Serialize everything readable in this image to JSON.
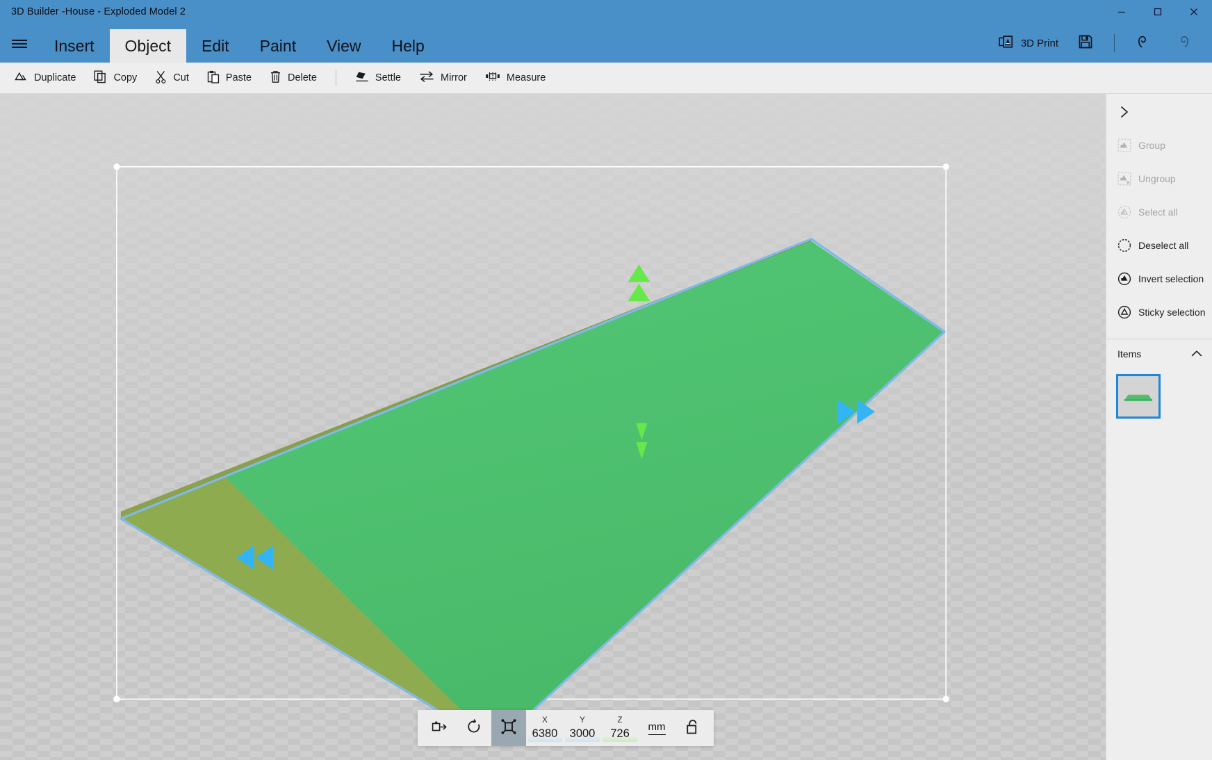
{
  "window": {
    "title": "3D Builder  -House - Exploded Model 2",
    "minimize_label": "Minimize",
    "maximize_label": "Maximize",
    "close_label": "Close",
    "accent_color": "#4a90c8"
  },
  "menubar": {
    "hamburger_label": "Menu",
    "tabs": [
      {
        "label": "Insert",
        "active": false
      },
      {
        "label": "Object",
        "active": true
      },
      {
        "label": "Edit",
        "active": false
      },
      {
        "label": "Paint",
        "active": false
      },
      {
        "label": "View",
        "active": false
      },
      {
        "label": "Help",
        "active": false
      }
    ],
    "print_label": "3D Print",
    "save_label": "Save",
    "undo_label": "Undo",
    "redo_label": "Redo",
    "redo_disabled": true
  },
  "toolbar": {
    "items": [
      {
        "label": "Duplicate",
        "icon": "duplicate-icon"
      },
      {
        "label": "Copy",
        "icon": "copy-icon"
      },
      {
        "label": "Cut",
        "icon": "cut-icon"
      },
      {
        "label": "Paste",
        "icon": "paste-icon"
      },
      {
        "label": "Delete",
        "icon": "delete-icon"
      }
    ],
    "items2": [
      {
        "label": "Settle",
        "icon": "settle-icon"
      },
      {
        "label": "Mirror",
        "icon": "mirror-icon"
      },
      {
        "label": "Measure",
        "icon": "measure-icon"
      }
    ]
  },
  "sidebar": {
    "expand_label": "Expand panel",
    "items": [
      {
        "label": "Group",
        "icon": "group-icon",
        "disabled": true
      },
      {
        "label": "Ungroup",
        "icon": "ungroup-icon",
        "disabled": true
      },
      {
        "label": "Select all",
        "icon": "select-all-icon",
        "disabled": true
      },
      {
        "label": "Deselect all",
        "icon": "deselect-all-icon",
        "disabled": false
      },
      {
        "label": "Invert selection",
        "icon": "invert-selection-icon",
        "disabled": false
      },
      {
        "label": "Sticky selection",
        "icon": "sticky-selection-icon",
        "disabled": false
      }
    ],
    "items_panel": {
      "title": "Items",
      "collapse_icon": "chevron-up-icon",
      "thumbnails": [
        {
          "name": "Exploded Model 2",
          "selected": true,
          "color": "#4cbf6e"
        }
      ]
    }
  },
  "viewport": {
    "selection_color": "#ffffff",
    "model_outline_color": "#7fb9e8",
    "model_face_light": "#4cbf6e",
    "model_face_dark": "#8fab4f",
    "gizmo_green": "#66e84a",
    "gizmo_blue": "#33b5f5",
    "gizmo_labels": {
      "up_arrows": "move-up-gizmo",
      "down_arrows": "move-down-gizmo",
      "left_arrows": "move-left-gizmo",
      "right_arrows": "move-right-gizmo"
    }
  },
  "bottombar": {
    "tools": [
      {
        "name": "move-tool",
        "icon": "move-icon",
        "active": false
      },
      {
        "name": "rotate-tool",
        "icon": "rotate-icon",
        "active": false
      },
      {
        "name": "scale-tool",
        "icon": "scale-icon",
        "active": true
      }
    ],
    "fields": [
      {
        "label": "X",
        "value": "6380",
        "bar_color": "#cfe4f2"
      },
      {
        "label": "Y",
        "value": "3000",
        "bar_color": "#cfe4f2"
      },
      {
        "label": "Z",
        "value": "726",
        "bar_color": "#ccecbf"
      }
    ],
    "unit": "mm",
    "lock_label": "Unlocked",
    "lock_icon": "unlock-icon"
  }
}
